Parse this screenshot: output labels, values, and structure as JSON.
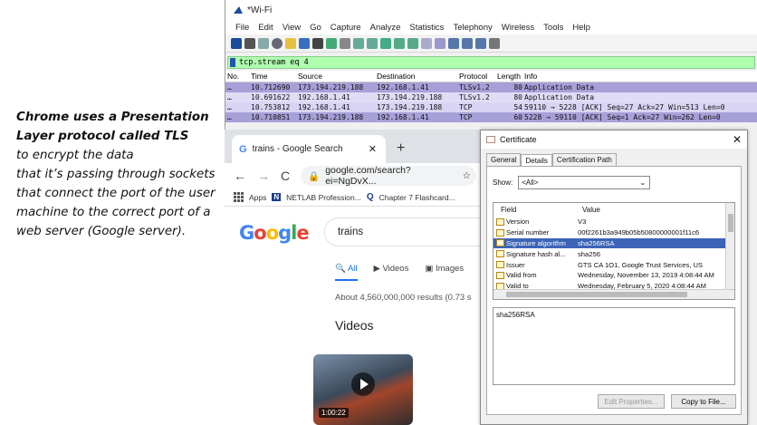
{
  "slide": {
    "bold_lines": [
      "Chrome uses a Presentation",
      "Layer protocol called TLS"
    ],
    "lines": [
      "to encrypt the data",
      "that it’s passing through sockets",
      "that connect the port of the user",
      "machine to the correct port of a",
      "web server (Google server)."
    ]
  },
  "wireshark": {
    "title": "*Wi-Fi",
    "menu": [
      "File",
      "Edit",
      "View",
      "Go",
      "Capture",
      "Analyze",
      "Statistics",
      "Telephony",
      "Wireless",
      "Tools",
      "Help"
    ],
    "filter": "tcp.stream eq 4",
    "columns": [
      "No.",
      "Time",
      "Source",
      "Destination",
      "Protocol",
      "Length",
      "Info"
    ],
    "rows": [
      {
        "no": "…",
        "time": "10.712690",
        "src": "173.194.219.188",
        "dst": "192.168.1.41",
        "proto": "TLSv1.2",
        "len": "80",
        "info": "Application Data"
      },
      {
        "no": "…",
        "time": "10.691622",
        "src": "192.168.1.41",
        "dst": "173.194.219.188",
        "proto": "TLSv1.2",
        "len": "80",
        "info": "Application Data"
      },
      {
        "no": "…",
        "time": "10.753812",
        "src": "192.168.1.41",
        "dst": "173.194.219.188",
        "proto": "TCP",
        "len": "54",
        "info": "59110 → 5228 [ACK] Seq=27 Ack=27 Win=513 Len=0"
      },
      {
        "no": "…",
        "time": "10.710851",
        "src": "173.194.219.188",
        "dst": "192.168.1.41",
        "proto": "TCP",
        "len": "60",
        "info": "5228 → 59110 [ACK] Seq=1 Ack=27 Win=262 Len=0"
      }
    ]
  },
  "chrome": {
    "tab_title": "trains - Google Search",
    "url": "google.com/search?ei=NgDvX...",
    "bookmarks": [
      "Apps",
      "NETLAB Profession...",
      "Chapter 7 Flashcard..."
    ],
    "search_query": "trains",
    "search_tabs": [
      "All",
      "Videos",
      "Images"
    ],
    "results_count": "About 4,560,000,000 results (0.73 s",
    "videos_heading": "Videos",
    "video_duration": "1:00:22",
    "logo": "Google"
  },
  "certificate": {
    "title": "Certificate",
    "tabs": [
      "General",
      "Details",
      "Certification Path"
    ],
    "show_label": "Show:",
    "show_value": "<All>",
    "field_header": "Field",
    "value_header": "Value",
    "fields": [
      {
        "field": "Version",
        "value": "V3"
      },
      {
        "field": "Serial number",
        "value": "00f2261b3a949b05b50800000001f11c6"
      },
      {
        "field": "Signature algorithm",
        "value": "sha256RSA"
      },
      {
        "field": "Signature hash al...",
        "value": "sha256"
      },
      {
        "field": "Issuer",
        "value": "GTS CA 1O1, Google Trust Services, US"
      },
      {
        "field": "Valid from",
        "value": "Wednesday, November 13, 2019 4:08:44 AM"
      },
      {
        "field": "Valid to",
        "value": "Wednesday, February 5, 2020 4:08:44 AM"
      }
    ],
    "selected_value": "sha256RSA",
    "buttons": [
      "Edit Properties...",
      "Copy to File..."
    ]
  },
  "colors": {
    "filter_bg": "#afffaf",
    "row_dark": "#a7a0d8",
    "row_light": "#e0dcf6",
    "selected_field": "#3c64b8"
  }
}
